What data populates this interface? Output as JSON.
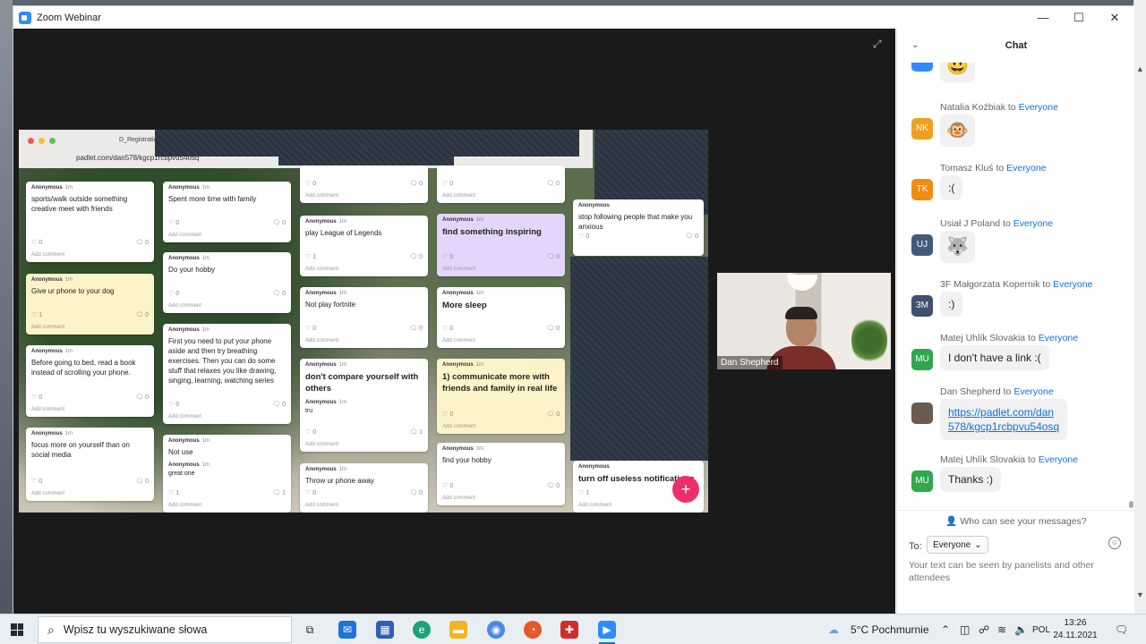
{
  "window": {
    "title": "Zoom Webinar"
  },
  "controls": {
    "minimize": "—",
    "maximize": "☐",
    "close": "✕"
  },
  "share": {
    "tab_label": "D_Registratio",
    "url": "padlet.com/dan578/kgcp1rcbpvu54osq",
    "cards": [
      {
        "author": "Anonymous",
        "time": "1m",
        "text": "sports/walk outside something creative meet with friends",
        "likes": "0",
        "comments": "0",
        "add": "Add comment"
      },
      {
        "author": "Anonymous",
        "time": "1m",
        "text": "Give ur phone to your dog",
        "likes": "1",
        "comments": "0",
        "add": "Add comment"
      },
      {
        "author": "Anonymous",
        "time": "1m",
        "text": "Before going to bed, read a book instead of scrolling your phone.",
        "likes": "0",
        "comments": "0",
        "add": "Add comment"
      },
      {
        "author": "Anonymous",
        "time": "1m",
        "text": "focus more on yourself than on social media",
        "likes": "0",
        "comments": "0",
        "add": "Add comment"
      },
      {
        "author": "Anonymous",
        "time": "1m",
        "text": "Spent more time with family",
        "likes": "0",
        "comments": "0",
        "add": "Add comment"
      },
      {
        "author": "Anonymous",
        "time": "1m",
        "text": "Do your hobby",
        "likes": "0",
        "comments": "0",
        "add": "Add comment"
      },
      {
        "author": "Anonymous",
        "time": "1m",
        "text": "First you need to put your phone aside and then try breathing exercises. Then you can do some stuff that relaxes you like drawing, singing, learning, watching series",
        "likes": "0",
        "comments": "0",
        "add": "Add comment"
      },
      {
        "author": "Anonymous",
        "time": "1m",
        "text": "Not use",
        "likes": "1",
        "comments": "1",
        "reply_author": "Anonymous",
        "reply_time": "1m",
        "reply": "great one",
        "add": "Add comment"
      },
      {
        "author": "",
        "time": "",
        "text": "",
        "likes": "0",
        "comments": "0",
        "add": "Add comment"
      },
      {
        "author": "Anonymous",
        "time": "1m",
        "text": "play League of Legends",
        "likes": "1",
        "comments": "0",
        "add": "Add comment"
      },
      {
        "author": "Anonymous",
        "time": "1m",
        "text": "Not play fortnite",
        "likes": "0",
        "comments": "0",
        "add": "Add comment"
      },
      {
        "author": "Anonymous",
        "time": "1m",
        "text": "don't compare yourself with others",
        "likes": "0",
        "comments": "1",
        "reply_author": "Anonymous",
        "reply_time": "1m",
        "reply": "tru",
        "add": "Add comment"
      },
      {
        "author": "Anonymous",
        "time": "1m",
        "text": "Throw ur phone away",
        "likes": "0",
        "comments": "0",
        "add": "Add comment"
      },
      {
        "author": "",
        "time": "",
        "text": "",
        "likes": "0",
        "comments": "0",
        "add": "Add comment"
      },
      {
        "author": "Anonymous",
        "time": "1m",
        "text": "find something inspiring",
        "likes": "0",
        "comments": "0",
        "add": "Add comment"
      },
      {
        "author": "Anonymous",
        "time": "1m",
        "text": "More sleep",
        "likes": "0",
        "comments": "0",
        "add": "Add comment"
      },
      {
        "author": "Anonymous",
        "time": "1m",
        "text": "1) communicate more with friends and family in real life",
        "likes": "0",
        "comments": "0",
        "add": "Add comment"
      },
      {
        "author": "Anonymous",
        "time": "1m",
        "text": "find your hobby",
        "likes": "0",
        "comments": "0",
        "add": "Add comment"
      },
      {
        "author": "Anonymous",
        "time": "",
        "text": "stop following people that make you anxious",
        "likes": "0",
        "comments": "0",
        "add": ""
      },
      {
        "author": "Anonymous",
        "time": "",
        "text": "turn off useless notifications",
        "likes": "1",
        "comments": "",
        "add": "Add comment"
      }
    ],
    "fab": "+"
  },
  "video": {
    "name": "Dan Shepherd"
  },
  "chat": {
    "title": "Chat",
    "to_word": "to",
    "messages": [
      {
        "initials": "GO",
        "color": "#2d8cff",
        "sender": "",
        "dest": "",
        "text": "😃",
        "emoji": true
      },
      {
        "initials": "NK",
        "color": "#f0a020",
        "sender": "Natalia Koźbiak",
        "dest": "Everyone",
        "text": "🐵",
        "emoji": true
      },
      {
        "initials": "TK",
        "color": "#f08c10",
        "sender": "Tomasz Kluś",
        "dest": "Everyone",
        "text": ":(",
        "emoji": false
      },
      {
        "initials": "UJ",
        "color": "#455a7a",
        "sender": "Usiał J Poland",
        "dest": "Everyone",
        "text": "🐺",
        "emoji": true
      },
      {
        "initials": "3M",
        "color": "#3f5070",
        "sender": "3F Małgorzata Kopernik",
        "dest": "Everyone",
        "text": ":)",
        "emoji": false
      },
      {
        "initials": "MU",
        "color": "#2fa84f",
        "sender": "Matej Uhlík Slovakia",
        "dest": "Everyone",
        "text": "I don't have a link :(",
        "emoji": false
      },
      {
        "initials": "",
        "color": "#6b5a4e",
        "sender": "Dan Shepherd",
        "dest": "Everyone",
        "text": "https://padlet.com/dan578/kgcp1rcbpvu54osq",
        "link_line1": "https://padlet.com/dan",
        "link_line2": "578/kgcp1rcbpvu54osq",
        "emoji": false
      },
      {
        "initials": "MU",
        "color": "#2fa84f",
        "sender": "Matej Uhlík Slovakia",
        "dest": "Everyone",
        "text": "Thanks :)",
        "emoji": false
      }
    ],
    "who_can_see": "Who can see your messages?",
    "to_label": "To:",
    "to_value": "Everyone",
    "compose_hint": "Your text can be seen by panelists and other attendees"
  },
  "taskbar": {
    "search_placeholder": "Wpisz tu wyszukiwane słowa",
    "weather": "5°C  Pochmurnie",
    "lang": "POL",
    "time": "13:26",
    "date": "24.11.2021"
  }
}
